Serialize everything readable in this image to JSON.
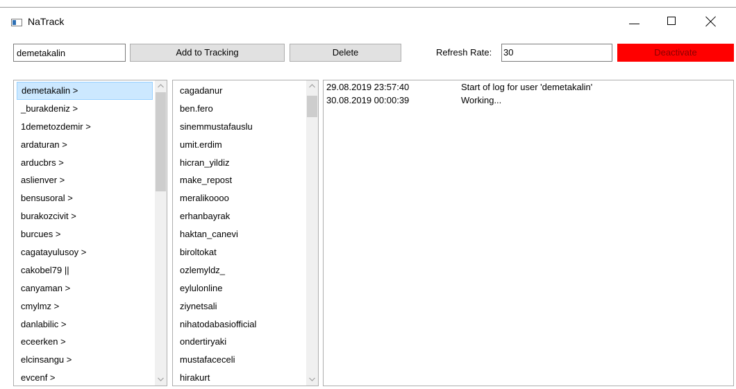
{
  "window": {
    "title": "NaTrack"
  },
  "toolbar": {
    "username_value": "demetakalin",
    "add_label": "Add to Tracking",
    "delete_label": "Delete",
    "refresh_label": "Refresh Rate:",
    "refresh_value": "30",
    "deactivate_label": "Deactivate"
  },
  "users": {
    "selected": 0,
    "items": [
      "demetakalin >",
      "_burakdeniz >",
      "1demetozdemir >",
      "ardaturan >",
      "arducbrs >",
      "aslienver >",
      "bensusoral >",
      "burakozcivit >",
      "burcues >",
      "cagatayulusoy >",
      "cakobel79 ||",
      "canyaman >",
      "cmylmz >",
      "danlabilic >",
      "eceerken >",
      "elcinsangu >",
      "evcenf >"
    ]
  },
  "followers": {
    "items": [
      "cagadanur",
      "ben.fero",
      "sinemmustafauslu",
      "umit.erdim",
      "hicran_yildiz",
      "make_repost",
      "meralikoooo",
      "erhanbayrak",
      "haktan_canevi",
      "biroltokat",
      "ozlemyldz_",
      "eylulonline",
      "ziynetsali",
      "nihatodabasiofficial",
      "ondertiryaki",
      "mustafaceceli",
      "hirakurt"
    ]
  },
  "log": {
    "entries": [
      {
        "time": "29.08.2019 23:57:40",
        "message": "Start of log for user 'demetakalin'"
      },
      {
        "time": "30.08.2019 00:00:39",
        "message": "Working..."
      }
    ]
  },
  "colors": {
    "deactivate_bg": "#ff0000",
    "selection_bg": "#cce8ff"
  }
}
